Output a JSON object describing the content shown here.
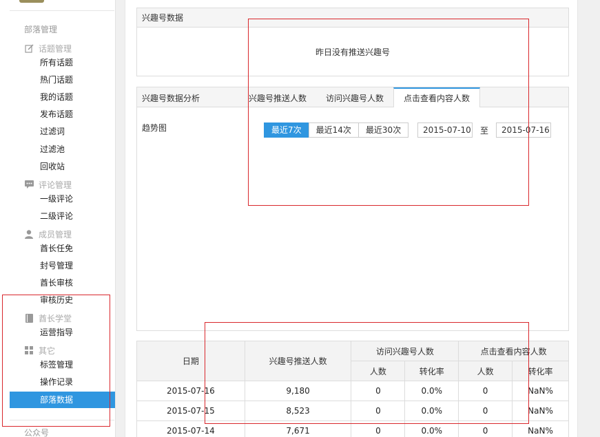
{
  "sidebar": {
    "section_title": "部落管理",
    "groups": {
      "topic": {
        "label": "话题管理",
        "items": [
          "所有话题",
          "热门话题",
          "我的话题",
          "发布话题",
          "过滤词",
          "过滤池",
          "回收站"
        ]
      },
      "comment": {
        "label": "评论管理",
        "items": [
          "一级评论",
          "二级评论"
        ]
      },
      "member": {
        "label": "成员管理",
        "items": [
          "酋长任免",
          "封号管理",
          "酋长审核",
          "审核历史"
        ]
      },
      "school": {
        "label": "酋长学堂",
        "items": [
          "运营指导"
        ]
      },
      "other": {
        "label": "其它",
        "items": [
          "标签管理",
          "操作记录",
          "部落数据"
        ]
      }
    },
    "bottom_section": "公众号",
    "active_item": "部落数据"
  },
  "interest_panel": {
    "title": "兴趣号数据",
    "empty_message": "昨日没有推送兴趣号"
  },
  "analysis_panel": {
    "title": "兴趣号数据分析",
    "tabs": [
      "兴趣号推送人数",
      "访问兴趣号人数",
      "点击查看内容人数"
    ],
    "selected_tab": "点击查看内容人数",
    "trend_label": "趋势图",
    "ranges": [
      "最近7次",
      "最近14次",
      "最近30次"
    ],
    "selected_range": "最近7次",
    "date_from": "2015-07-10",
    "date_to_label": "至",
    "date_to": "2015-07-16"
  },
  "table": {
    "headers": {
      "date": "日期",
      "push": "兴趣号推送人数",
      "visit": "访问兴趣号人数",
      "click": "点击查看内容人数",
      "people": "人数",
      "rate": "转化率"
    },
    "rows": [
      {
        "date": "2015-07-16",
        "push": "9,180",
        "visit_people": "0",
        "visit_rate": "0.0%",
        "click_people": "0",
        "click_rate": "NaN%"
      },
      {
        "date": "2015-07-15",
        "push": "8,523",
        "visit_people": "0",
        "visit_rate": "0.0%",
        "click_people": "0",
        "click_rate": "NaN%"
      },
      {
        "date": "2015-07-14",
        "push": "7,671",
        "visit_people": "0",
        "visit_rate": "0.0%",
        "click_people": "0",
        "click_rate": "NaN%"
      }
    ]
  },
  "colors": {
    "accent": "#2f96e0",
    "annotation_red": "#d9262b"
  }
}
